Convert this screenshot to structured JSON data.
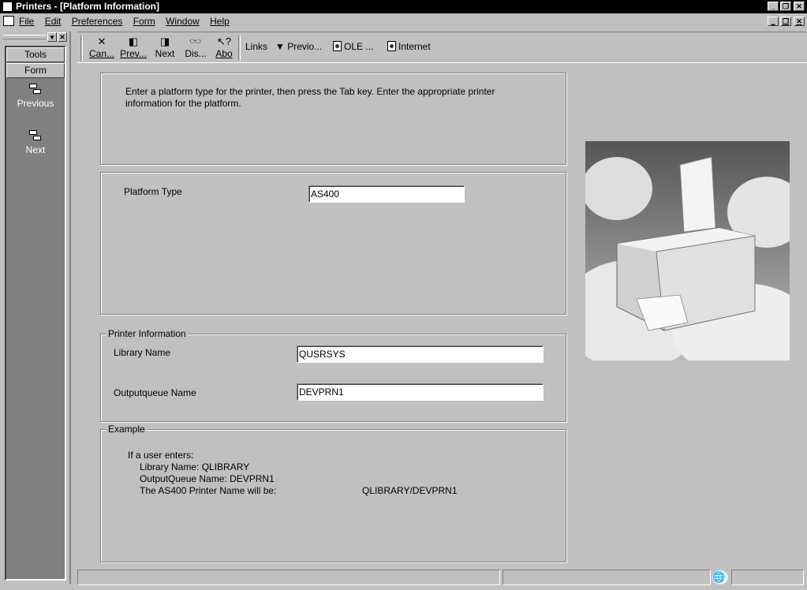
{
  "window": {
    "title": "Printers - [Platform Information]"
  },
  "menu": [
    "File",
    "Edit",
    "Preferences",
    "Form",
    "Window",
    "Help"
  ],
  "sidebar": {
    "tools": "Tools",
    "form": "Form",
    "items": [
      {
        "label": "Previous",
        "icon": "form-nav-icon"
      },
      {
        "label": "Next",
        "icon": "form-nav-icon"
      }
    ]
  },
  "toolbar": {
    "buttons": [
      {
        "label": "Can...",
        "icon": "x"
      },
      {
        "label": "Prev...",
        "icon": "prev"
      },
      {
        "label": "Next",
        "icon": "next"
      },
      {
        "label": "Dis...",
        "icon": "display"
      },
      {
        "label": "Abo",
        "icon": "about"
      }
    ],
    "links": "Links",
    "previous": "Previo...",
    "ole": "OLE ...",
    "internet": "Internet"
  },
  "instructions": "Enter a platform type for the printer, then press the Tab key.  Enter the appropriate printer information for the platform.",
  "platform": {
    "label": "Platform Type",
    "value": "AS400"
  },
  "printer_info": {
    "legend": "Printer Information",
    "library_label": "Library Name",
    "library_value": "QUSRSYS",
    "queue_label": "Outputqueue Name",
    "queue_value": "DEVPRN1"
  },
  "example": {
    "legend": "Example",
    "line1": "If a user enters:",
    "line2": "Library Name: QLIBRARY",
    "line3": "OutputQueue Name: DEVPRN1",
    "line4": "The AS400 Printer Name will be:",
    "result": "QLIBRARY/DEVPRN1"
  }
}
